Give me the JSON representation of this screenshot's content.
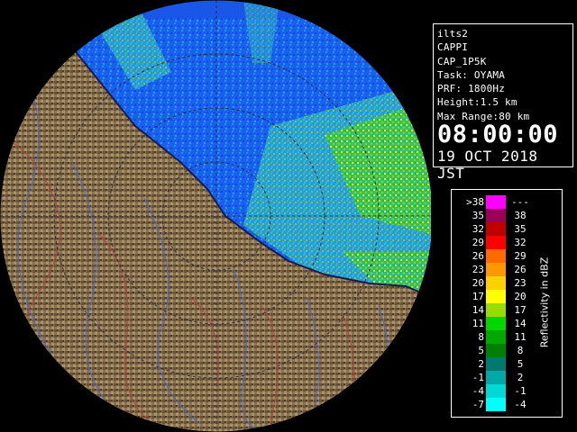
{
  "info": {
    "site": "ilts2",
    "product": "CAPPI",
    "scan": "CAP_1P5K",
    "task": "Task: OYAMA",
    "prf": "PRF: 1800Hz",
    "height": "Height:1.5 km",
    "max_range": "Max Range:80 km",
    "time": "08:00:00",
    "date": "19 OCT 2018 JST"
  },
  "legend": {
    "title": "Reflectivity in dBZ",
    "rows": [
      {
        "lo": ">38",
        "hi": "---",
        "color": "#ff00ff"
      },
      {
        "lo": "35",
        "hi": "38",
        "color": "#9a0058"
      },
      {
        "lo": "32",
        "hi": "35",
        "color": "#c00000"
      },
      {
        "lo": "29",
        "hi": "32",
        "color": "#ff0000"
      },
      {
        "lo": "26",
        "hi": "29",
        "color": "#ff6a00"
      },
      {
        "lo": "23",
        "hi": "26",
        "color": "#ff9800"
      },
      {
        "lo": "20",
        "hi": "23",
        "color": "#ffd000"
      },
      {
        "lo": "17",
        "hi": "20",
        "color": "#ffff00"
      },
      {
        "lo": "14",
        "hi": "17",
        "color": "#9adc00"
      },
      {
        "lo": "11",
        "hi": "14",
        "color": "#00d800"
      },
      {
        "lo": "8",
        "hi": "11",
        "color": "#00a800"
      },
      {
        "lo": "5",
        "hi": "8",
        "color": "#008000"
      },
      {
        "lo": "2",
        "hi": "5",
        "color": "#007a6e"
      },
      {
        "lo": "-1",
        "hi": "2",
        "color": "#00a8a8"
      },
      {
        "lo": "-4",
        "hi": "-1",
        "color": "#00d8d8"
      },
      {
        "lo": "-7",
        "hi": "-4",
        "color": "#00ffff"
      }
    ]
  },
  "colors": {
    "background": "#000000",
    "sea": "#1a56e8",
    "land": "#8a7250",
    "coast": "#1a1a50",
    "rivers": "#4a66cc",
    "boundaries": "#b04040"
  }
}
